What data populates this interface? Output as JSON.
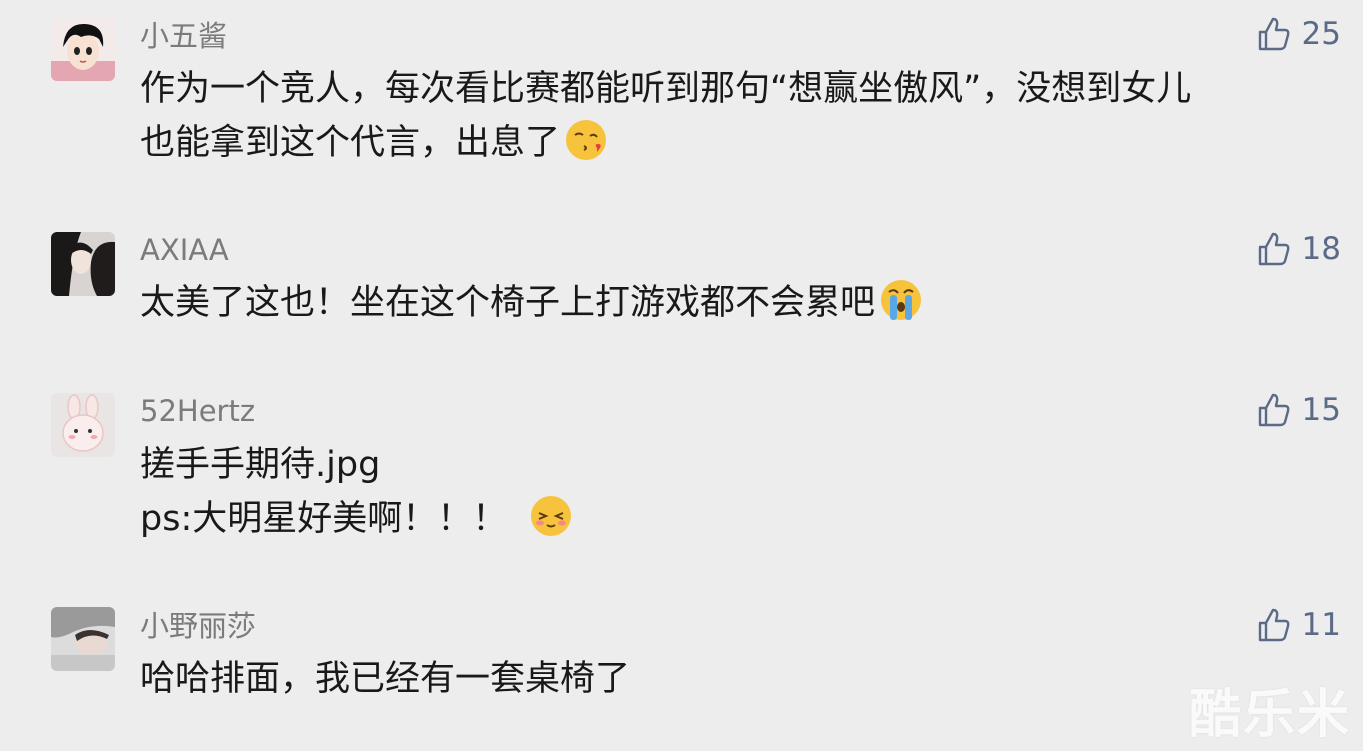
{
  "comments": [
    {
      "username": "小五酱",
      "likes": "25",
      "lines": [
        "作为一个竞人，每次看比赛都能听到那句“想赢坐傲风”，没想到女儿",
        "也能拿到这个代言，出息了"
      ],
      "emoji": "kiss-emoji"
    },
    {
      "username": "AXIAA",
      "likes": "18",
      "lines": [
        "太美了这也！坐在这个椅子上打游戏都不会累吧"
      ],
      "emoji": "crying-emoji"
    },
    {
      "username": "52Hertz",
      "likes": "15",
      "lines": [
        "搓手手期待.jpg",
        "ps:大明星好美啊！！！"
      ],
      "emoji": "smiling-closed-eyes-emoji"
    },
    {
      "username": "小野丽莎",
      "likes": "11",
      "lines": [
        "哈哈排面，我已经有一套桌椅了"
      ],
      "emoji": ""
    }
  ],
  "watermark": "酷乐米",
  "colors": {
    "background": "#ededed",
    "username": "#7b7b7b",
    "like": "#5b6a86",
    "text": "#191919"
  },
  "icons": {
    "like": "thumbs-up-icon"
  }
}
